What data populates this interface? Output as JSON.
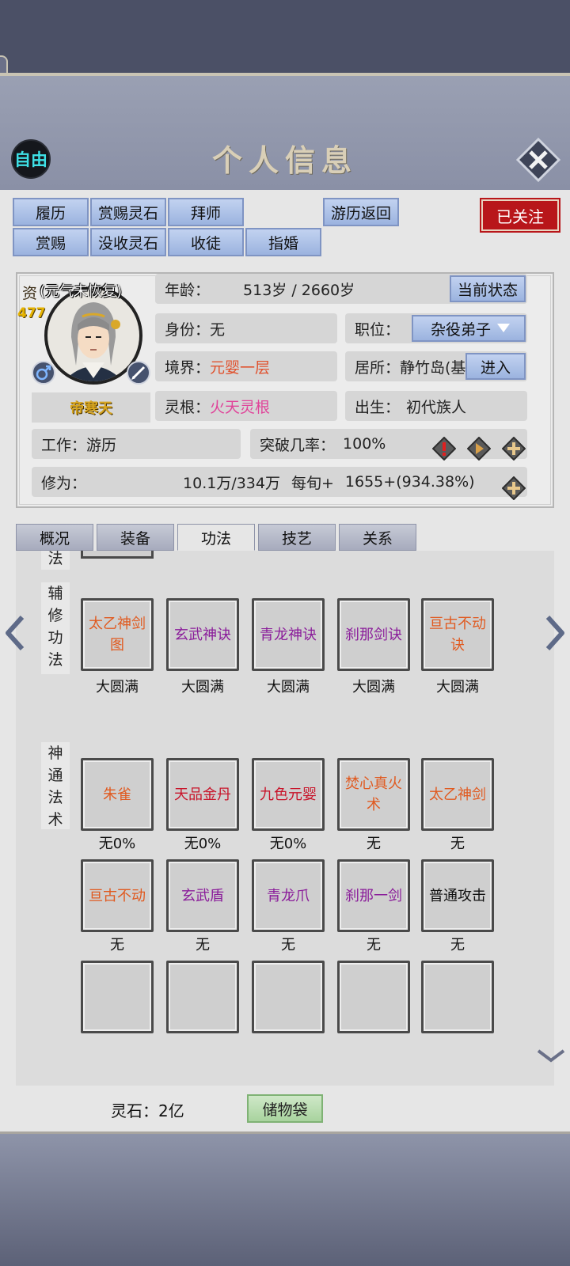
{
  "header": {
    "mode_label": "自由",
    "title": "个人信息"
  },
  "actions": {
    "row1": [
      "履历",
      "赏赐灵石",
      "拜师",
      "游历返回"
    ],
    "row2": [
      "赏赐",
      "没收灵石",
      "收徒",
      "指婚"
    ],
    "followed": "已关注"
  },
  "profile": {
    "zi_label": "资",
    "zi_value": "477",
    "mood": "(元气未恢复)",
    "name": "帝寒天",
    "age_label": "年龄：",
    "age_value": "513岁 / 2660岁",
    "status_button": "当前状态",
    "identity_label": "身份：",
    "identity_value": "无",
    "position_label": "职位：",
    "position_value": "杂役弟子",
    "realm_label": "境界：",
    "realm_value": "元婴一层",
    "residence_label": "居所：",
    "residence_value": "静竹岛(基",
    "enter_button": "进入",
    "root_label": "灵根：",
    "root_value": "火天灵根",
    "birth_label": "出生：",
    "birth_value": "初代族人",
    "work_label": "工作：",
    "work_value": "游历",
    "breakthrough_label": "突破几率：",
    "breakthrough_value": "100%",
    "cultivation_label": "修为：",
    "cultivation_value": "10.1万/334万",
    "per_turn_label": "每旬+",
    "per_turn_value": "1655+(934.38%)"
  },
  "tabs": [
    "概况",
    "装备",
    "功法",
    "技艺",
    "关系"
  ],
  "active_tab": "功法",
  "skills": {
    "top_partial_label": "法",
    "aux_label": [
      "辅",
      "修",
      "功",
      "法"
    ],
    "aux": [
      {
        "name": "太乙神剑图",
        "level": "大圆满",
        "color": "#e05a20"
      },
      {
        "name": "玄武神诀",
        "level": "大圆满",
        "color": "#8a1c9a"
      },
      {
        "name": "青龙神诀",
        "level": "大圆满",
        "color": "#8a1c9a"
      },
      {
        "name": "刹那剑诀",
        "level": "大圆满",
        "color": "#8a1c9a"
      },
      {
        "name": "亘古不动诀",
        "level": "大圆满",
        "color": "#e05a20"
      }
    ],
    "magic_label": [
      "神",
      "通",
      "法",
      "术"
    ],
    "magic_row1": [
      {
        "name": "朱雀",
        "level": "无0%",
        "color": "#e05a20"
      },
      {
        "name": "天品金丹",
        "level": "无0%",
        "color": "#c8142a"
      },
      {
        "name": "九色元婴",
        "level": "无0%",
        "color": "#c8142a"
      },
      {
        "name": "焚心真火术",
        "level": "无",
        "color": "#e05a20"
      },
      {
        "name": "太乙神剑",
        "level": "无",
        "color": "#e05a20"
      }
    ],
    "magic_row2": [
      {
        "name": "亘古不动",
        "level": "无",
        "color": "#e05a20"
      },
      {
        "name": "玄武盾",
        "level": "无",
        "color": "#8a1c9a"
      },
      {
        "name": "青龙爪",
        "level": "无",
        "color": "#8a1c9a"
      },
      {
        "name": "刹那一剑",
        "level": "无",
        "color": "#8a1c9a"
      },
      {
        "name": "普通攻击",
        "level": "无",
        "color": "#111111"
      }
    ]
  },
  "footer": {
    "stone_label": "灵石：2亿",
    "bag_button": "储物袋"
  }
}
